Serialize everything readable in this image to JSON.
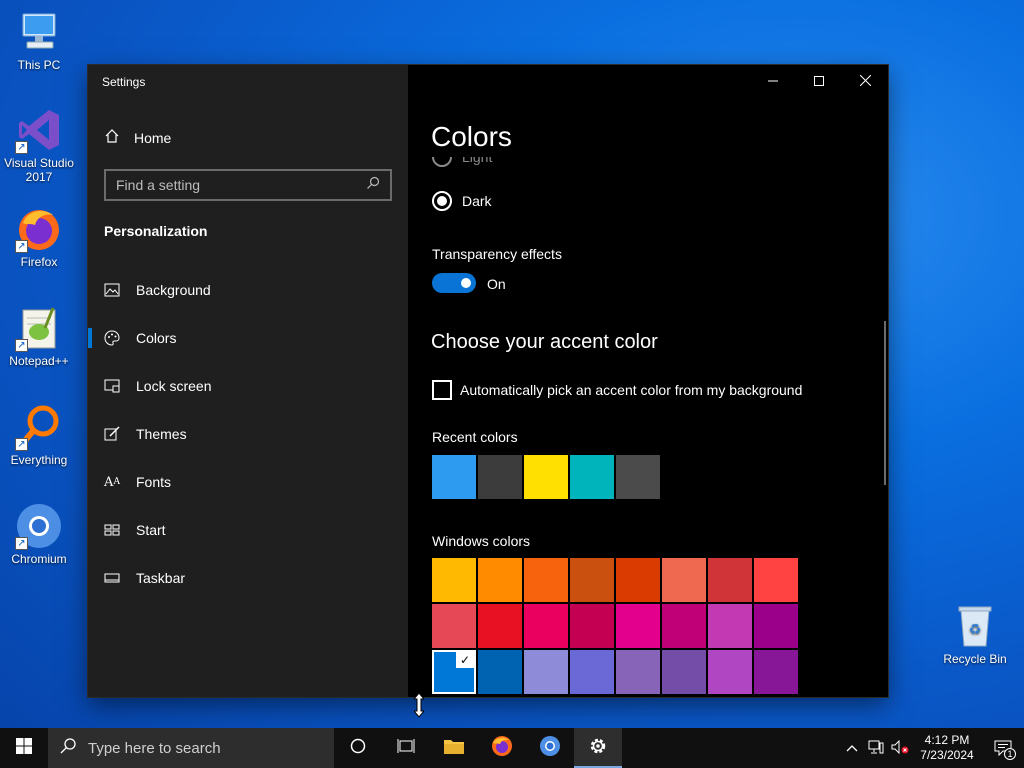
{
  "desktop": {
    "icons": [
      {
        "label": "This PC"
      },
      {
        "label": "Visual Studio 2017"
      },
      {
        "label": "Firefox"
      },
      {
        "label": "Notepad++"
      },
      {
        "label": "Everything"
      },
      {
        "label": "Chromium"
      },
      {
        "label": "Recycle Bin"
      }
    ]
  },
  "window": {
    "app_title": "Settings",
    "nav": {
      "home": "Home",
      "search_placeholder": "Find a setting",
      "section": "Personalization",
      "items": [
        {
          "label": "Background",
          "icon": "picture-icon"
        },
        {
          "label": "Colors",
          "icon": "palette-icon",
          "selected": true
        },
        {
          "label": "Lock screen",
          "icon": "lock-screen-icon"
        },
        {
          "label": "Themes",
          "icon": "brush-icon"
        },
        {
          "label": "Fonts",
          "icon": "fonts-icon"
        },
        {
          "label": "Start",
          "icon": "start-icon"
        },
        {
          "label": "Taskbar",
          "icon": "taskbar-icon"
        }
      ]
    },
    "content": {
      "page_title": "Colors",
      "mode_option_partial": "Light",
      "mode_option_dark": "Dark",
      "transparency_label": "Transparency effects",
      "transparency_state": "On",
      "accent_heading": "Choose your accent color",
      "auto_pick_label": "Automatically pick an accent color from my background",
      "recent_label": "Recent colors",
      "recent_colors": [
        "#2d9bf0",
        "#3c3c3c",
        "#ffe000",
        "#00b4bc",
        "#4b4b4b"
      ],
      "windows_label": "Windows colors",
      "windows_colors": [
        "#ffb900",
        "#ff8c00",
        "#f7630c",
        "#ca5010",
        "#da3b01",
        "#ef6950",
        "#d13438",
        "#ff4343",
        "#e74856",
        "#e81123",
        "#ea005e",
        "#c30052",
        "#e3008c",
        "#bf0077",
        "#c239b3",
        "#9a0089",
        "#0078d7",
        "#0063b1",
        "#8e8cd8",
        "#6b69d6",
        "#8764b8",
        "#744da9",
        "#b146c2",
        "#881798"
      ],
      "selected_windows_color_index": 16
    }
  },
  "taskbar": {
    "search_placeholder": "Type here to search",
    "time": "4:12 PM",
    "date": "7/23/2024",
    "notification_count": "1"
  }
}
